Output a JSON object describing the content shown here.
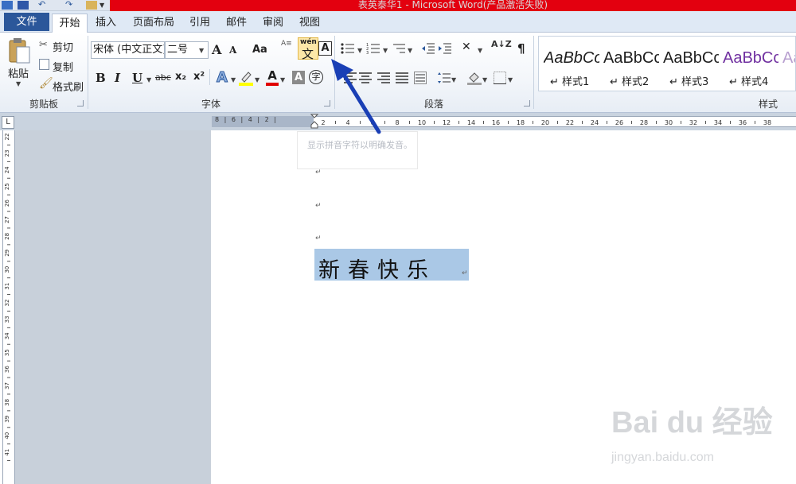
{
  "window": {
    "title": "表英泰华1 - Microsoft Word(产品激活失败)"
  },
  "tabs": [
    {
      "label": "文件"
    },
    {
      "label": "开始"
    },
    {
      "label": "插入"
    },
    {
      "label": "页面布局"
    },
    {
      "label": "引用"
    },
    {
      "label": "邮件"
    },
    {
      "label": "审阅"
    },
    {
      "label": "视图"
    }
  ],
  "clipboard": {
    "paste": "粘贴",
    "cut": "剪切",
    "copy": "复制",
    "format_painter": "格式刷",
    "group_label": "剪贴板"
  },
  "font": {
    "family": "宋体 (中文正文)",
    "size": "二号",
    "group_label": "字体",
    "grow_icon": "A",
    "case_label": "Aa",
    "bold": "B",
    "italic": "I",
    "underline": "U",
    "strike": "abc",
    "subscript": "x₂",
    "superscript": "x²",
    "phonetic_top": "wén",
    "phonetic_bottom": "文",
    "phonetic_small_top": "A≡",
    "border_char": "A",
    "highlight_color": "#ffff00",
    "font_color": "#e00000",
    "shade_char": "A",
    "enclose_char": "字"
  },
  "paragraph": {
    "group_label": "段落",
    "sort_label": "A↓Z"
  },
  "styles": {
    "group_label": "样式",
    "items": [
      {
        "sample": "AaBbCcDd",
        "name": "样式1",
        "italic": true,
        "color": "#000000"
      },
      {
        "sample": "AaBbCcDd",
        "name": "样式2",
        "italic": false,
        "color": "#000000"
      },
      {
        "sample": "AaBbCcDd",
        "name": "样式3",
        "italic": false,
        "color": "#000000"
      },
      {
        "sample": "AaBbCcDd",
        "name": "样式4",
        "italic": false,
        "color": "#7030a0"
      },
      {
        "sample": "Aa",
        "name": "",
        "italic": false,
        "color": "#7030a0"
      }
    ]
  },
  "ruler": {
    "tab_selector": "L",
    "h_labels_left": "8 | 6 | 4 | 2 |",
    "h_labels": [
      "2",
      "4",
      "6",
      "8",
      "10",
      "12",
      "14",
      "16",
      "18",
      "20",
      "22",
      "24",
      "26",
      "28",
      "30",
      "32",
      "34",
      "36",
      "38"
    ],
    "v_labels": [
      "22",
      "23",
      "24",
      "25",
      "26",
      "27",
      "28",
      "29",
      "30",
      "31",
      "32",
      "33",
      "34",
      "35",
      "36",
      "37",
      "38",
      "39",
      "40",
      "41"
    ]
  },
  "tooltip": {
    "text": "显示拼音字符以明确发音。"
  },
  "document": {
    "paragraph_mark": "↵",
    "selected_text": "新春快乐"
  },
  "watermark": {
    "brand": "Bai du 经验",
    "url": "jingyan.baidu.com"
  },
  "annotation": {
    "arrow_color": "#1a3fb5"
  }
}
